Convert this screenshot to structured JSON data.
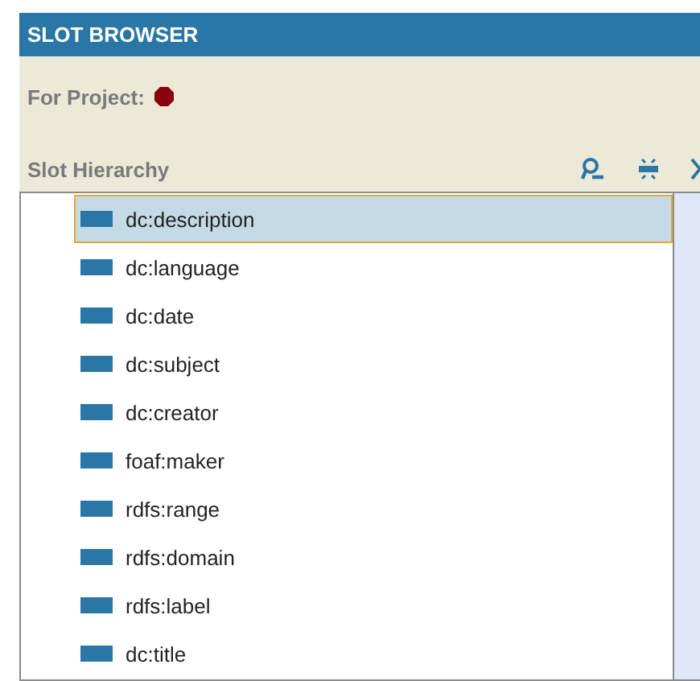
{
  "panel": {
    "title": "SLOT BROWSER",
    "project_label": "For Project:",
    "hierarchy_label": "Slot Hierarchy"
  },
  "slots": [
    {
      "name": "dc:description",
      "selected": true
    },
    {
      "name": "dc:language",
      "selected": false
    },
    {
      "name": "dc:date",
      "selected": false
    },
    {
      "name": "dc:subject",
      "selected": false
    },
    {
      "name": "dc:creator",
      "selected": false
    },
    {
      "name": "foaf:maker",
      "selected": false
    },
    {
      "name": "rdfs:range",
      "selected": false
    },
    {
      "name": "rdfs:domain",
      "selected": false
    },
    {
      "name": "rdfs:label",
      "selected": false
    },
    {
      "name": "dc:title",
      "selected": false
    }
  ]
}
